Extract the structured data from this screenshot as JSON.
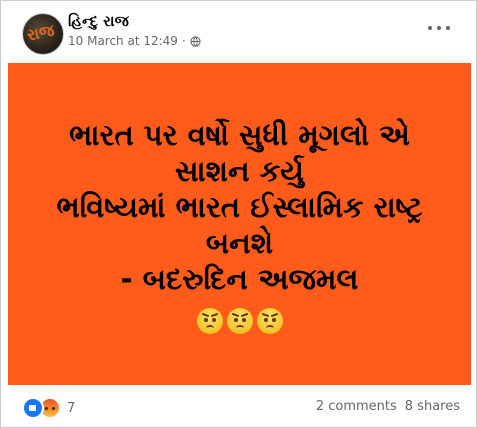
{
  "post": {
    "page_name": "હિન્દુ રાજ",
    "timestamp": "10 March at 12:49",
    "separator": "·",
    "privacy_icon": "globe-icon",
    "avatar_text": "રાજ",
    "image": {
      "background_color": "#ff5b1a",
      "lines": [
        "ભારત પર વર્ષો સુધી મૂગલો એ",
        "સાશન કર્યુ",
        "ભવિષ્યમાં ભારત ઈસ્લામિક રાષ્ટ્ર",
        "બનશે",
        "- બદરુદિન અજમલ"
      ],
      "emojis": [
        "angry-face",
        "angry-face",
        "angry-face"
      ]
    }
  },
  "footer": {
    "reactions": [
      "like-reaction",
      "angry-reaction"
    ],
    "reaction_count": "7",
    "comments": "2 comments",
    "shares": "8 shares"
  }
}
